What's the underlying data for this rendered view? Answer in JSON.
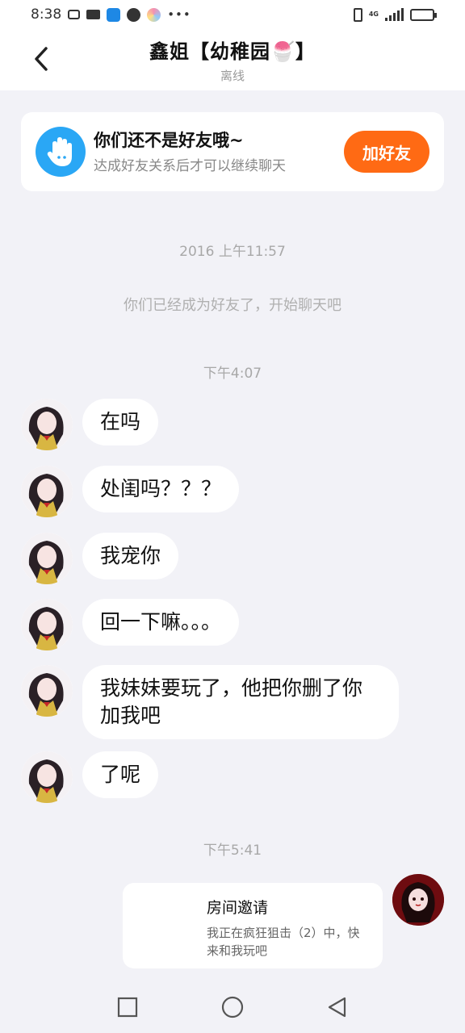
{
  "status_bar": {
    "time": "8:38",
    "network": "4G"
  },
  "header": {
    "title": "鑫姐【幼稚园🍧】",
    "subtitle": "离线"
  },
  "friend_banner": {
    "title": "你们还不是好友哦~",
    "description": "达成好友关系后才可以继续聊天",
    "button": "加好友"
  },
  "timeline": {
    "first_timestamp": "2016 上午11:57",
    "system_message": "你们已经成为好友了，开始聊天吧",
    "second_timestamp": "下午4:07",
    "third_timestamp": "下午5:41"
  },
  "messages": [
    {
      "text": "在吗"
    },
    {
      "text": "处闺吗？？？"
    },
    {
      "text": "我宠你"
    },
    {
      "text": "回一下嘛。。。"
    },
    {
      "text": "我妹妹要玩了，他把你删了你加我吧"
    },
    {
      "text": "了呢"
    }
  ],
  "invite_card": {
    "title": "房间邀请",
    "description": "我正在疯狂狙击（2）中，快来和我玩吧"
  },
  "colors": {
    "accent_orange": "#ff6a14",
    "hand_icon_blue": "#2aa7f5",
    "background": "#f2f2f7"
  },
  "icons": [
    "back-arrow-icon",
    "hand-icon",
    "recent-apps-icon",
    "home-icon",
    "back-nav-icon"
  ]
}
